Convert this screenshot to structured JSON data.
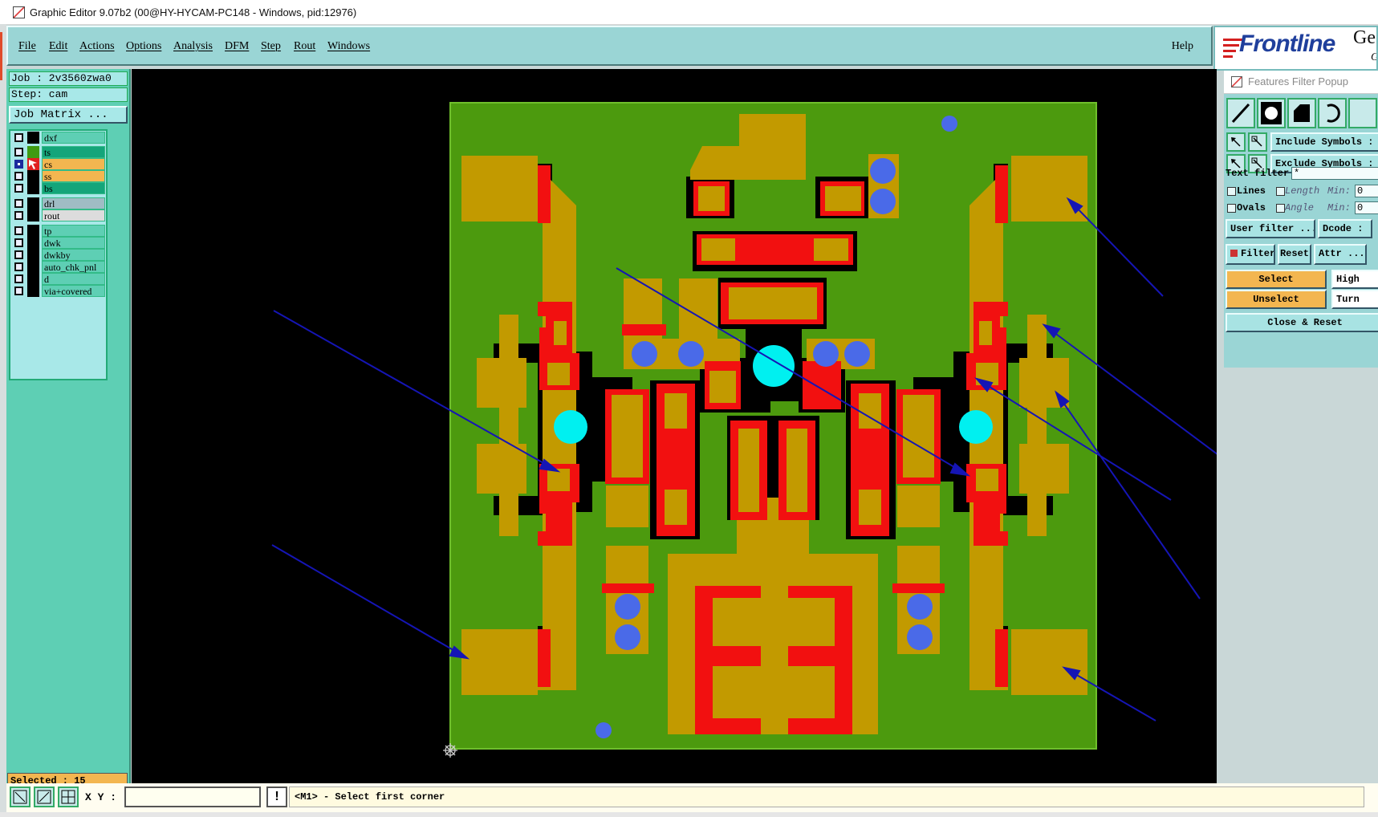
{
  "window": {
    "title": "Graphic Editor 9.07b2 (00@HY-HYCAM-PC148 - Windows, pid:12976)"
  },
  "menu": {
    "items": [
      "File",
      "Edit",
      "Actions",
      "Options",
      "Analysis",
      "DFM",
      "Step",
      "Rout",
      "Windows"
    ],
    "help": "Help"
  },
  "logo": {
    "brand": "Frontline",
    "extra": "Ge",
    "extra2": "G"
  },
  "job": {
    "job_line": "Job : 2v3560zwa0",
    "step_line": "Step: cam",
    "matrix_button": "Job Matrix ..."
  },
  "layers": [
    {
      "name": "dxf",
      "checked": false,
      "swatch": "#000000",
      "bg": "#5ecfb4"
    },
    {
      "name": "ts",
      "checked": false,
      "swatch": "#3f9b12",
      "bg": "#14a57a"
    },
    {
      "name": "cs",
      "checked": true,
      "swatch": "#e02020",
      "bg": "#f3b650"
    },
    {
      "name": "ss",
      "checked": false,
      "swatch": "#000000",
      "bg": "#f3b650"
    },
    {
      "name": "bs",
      "checked": false,
      "swatch": "#000000",
      "bg": "#14a57a"
    },
    {
      "name": "drl",
      "checked": false,
      "swatch": "#000000",
      "bg": "#9fbcc4"
    },
    {
      "name": "rout",
      "checked": false,
      "swatch": "#000000",
      "bg": "#dcdcdc"
    },
    {
      "name": "tp",
      "checked": false,
      "swatch": "#000000",
      "bg": "#5ecfb4"
    },
    {
      "name": "dwk",
      "checked": false,
      "swatch": "#000000",
      "bg": "#5ecfb4"
    },
    {
      "name": "dwkby",
      "checked": false,
      "swatch": "#000000",
      "bg": "#5ecfb4"
    },
    {
      "name": "auto_chk_pnl",
      "checked": false,
      "swatch": "#000000",
      "bg": "#5ecfb4"
    },
    {
      "name": "d",
      "checked": false,
      "swatch": "#000000",
      "bg": "#5ecfb4"
    },
    {
      "name": "via+covered",
      "checked": false,
      "swatch": "#000000",
      "bg": "#5ecfb4"
    }
  ],
  "selected": "Selected : 15",
  "filter": {
    "title": "Features Filter Popup",
    "include_symbols": "Include Symbols :",
    "exclude_symbols": "Exclude Symbols :",
    "text_filter_label": "Text filter",
    "text_filter_value": "*",
    "lines": "Lines",
    "ovals": "Ovals",
    "length": "Length",
    "angle": "Angle",
    "min": "Min:",
    "length_min": "0",
    "angle_min": "0",
    "user_filter": "User filter ...",
    "dcode": "Dcode :",
    "filter": "Filter",
    "reset": "Reset",
    "attr": "Attr ...",
    "select": "Select",
    "unselect": "Unselect",
    "high": "High",
    "turn": "Turn",
    "close_reset": "Close & Reset"
  },
  "status": {
    "xy_label": "X Y :",
    "xy_value": "",
    "exclaim": "!",
    "prompt": "<M1> - Select first corner"
  },
  "colors": {
    "board": "#4c9a0e",
    "copper": "#c29a00",
    "red": "#f21010",
    "via": "#4a6ae8",
    "hole": "#00f0f0",
    "arrow": "#1515b5"
  }
}
